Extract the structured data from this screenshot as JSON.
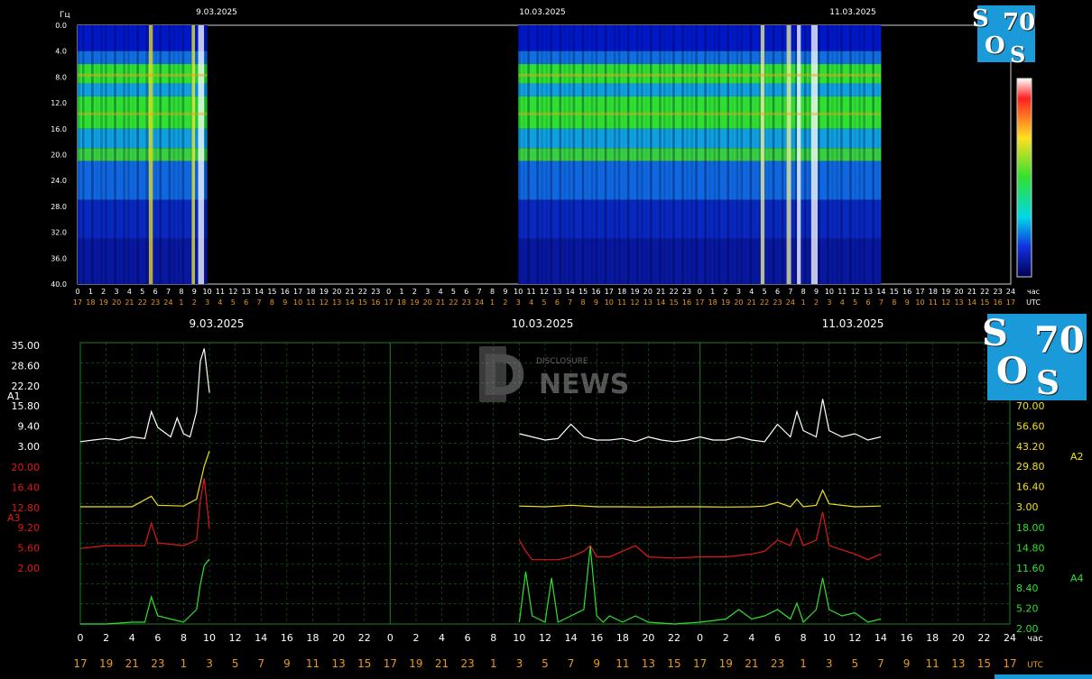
{
  "logo": {
    "s1": "S",
    "seventy": "70",
    "o": "O",
    "s2": "S"
  },
  "watermark": {
    "d": "D",
    "disclosure": "DISCLOSURE",
    "news": "NEWS"
  },
  "spectrogram": {
    "freq_unit": "Гц",
    "dates": [
      "9.03.2025",
      "10.03.2025",
      "11.03.2025"
    ],
    "freq_ticks": [
      "0.0",
      "4.0",
      "8.0",
      "12.0",
      "16.0",
      "20.0",
      "24.0",
      "28.0",
      "32.0",
      "36.0",
      "40.0"
    ],
    "hour_unit": "час",
    "utc_label": "UTC",
    "time_row_1": [
      "0",
      "1",
      "2",
      "3",
      "4",
      "5",
      "6",
      "7",
      "8",
      "9",
      "10",
      "11",
      "12",
      "13",
      "14",
      "15",
      "16",
      "17",
      "18",
      "19",
      "20",
      "21",
      "22",
      "23",
      "0",
      "1",
      "2",
      "3",
      "4",
      "5",
      "6",
      "7",
      "8",
      "9",
      "10",
      "11",
      "12",
      "13",
      "14",
      "15",
      "16",
      "17",
      "18",
      "19",
      "20",
      "21",
      "22",
      "23",
      "0",
      "1",
      "2",
      "3",
      "4",
      "5",
      "6",
      "7",
      "8",
      "9",
      "10",
      "11",
      "12",
      "13",
      "14",
      "15",
      "16",
      "17",
      "18",
      "19",
      "20",
      "21",
      "22",
      "23",
      "24"
    ],
    "time_row_2": [
      "17",
      "18",
      "19",
      "20",
      "21",
      "22",
      "23",
      "24",
      "1",
      "2",
      "3",
      "4",
      "5",
      "6",
      "7",
      "8",
      "9",
      "10",
      "11",
      "12",
      "13",
      "14",
      "15",
      "16",
      "17",
      "18",
      "19",
      "20",
      "21",
      "22",
      "23",
      "24",
      "1",
      "2",
      "3",
      "4",
      "5",
      "6",
      "7",
      "8",
      "9",
      "10",
      "11",
      "12",
      "13",
      "14",
      "15",
      "16",
      "17",
      "18",
      "19",
      "20",
      "21",
      "22",
      "23",
      "24",
      "1",
      "2",
      "3",
      "4",
      "5",
      "6",
      "7",
      "8",
      "9",
      "10",
      "11",
      "12",
      "13",
      "14",
      "15",
      "16",
      "17"
    ],
    "colors": {
      "black": "#000000",
      "blue": "#0018c8",
      "cyan": "#00c8d8",
      "green": "#30e030",
      "yellow": "#f0e020",
      "red": "#e01010",
      "white": "#ffffff"
    }
  },
  "amplitude": {
    "dates": [
      "9.03.2025",
      "10.03.2025",
      "11.03.2025"
    ],
    "channels": [
      {
        "name": "A1",
        "color": "#ffffff",
        "side": "left",
        "ticks": [
          "35.00",
          "28.60",
          "22.20",
          "15.80",
          "9.40",
          "3.00"
        ]
      },
      {
        "name": "A3",
        "color": "#e01818",
        "side": "left",
        "ticks": [
          "20.00",
          "16.40",
          "12.80",
          "9.20",
          "5.60",
          "2.00"
        ]
      },
      {
        "name": "A2",
        "color": "#f0e020",
        "side": "right",
        "ticks": [
          "70.00",
          "56.60",
          "43.20",
          "29.80",
          "16.40",
          "3.00"
        ]
      },
      {
        "name": "A4",
        "color": "#30e030",
        "side": "right",
        "ticks": [
          "18.00",
          "14.80",
          "11.60",
          "8.40",
          "5.20",
          "2.00"
        ]
      }
    ],
    "hour_unit": "час",
    "utc_label": "UTC",
    "time_row_1": [
      "0",
      "2",
      "4",
      "6",
      "8",
      "10",
      "12",
      "14",
      "16",
      "18",
      "20",
      "22",
      "0",
      "2",
      "4",
      "6",
      "8",
      "10",
      "12",
      "14",
      "16",
      "18",
      "20",
      "22",
      "0",
      "2",
      "4",
      "6",
      "8",
      "10",
      "12",
      "14",
      "16",
      "18",
      "20",
      "22",
      "24"
    ],
    "time_row_2": [
      "17",
      "19",
      "21",
      "23",
      "1",
      "3",
      "5",
      "7",
      "9",
      "11",
      "13",
      "15",
      "17",
      "19",
      "21",
      "23",
      "1",
      "3",
      "5",
      "7",
      "9",
      "11",
      "13",
      "15",
      "17",
      "19",
      "21",
      "23",
      "1",
      "3",
      "5",
      "7",
      "9",
      "11",
      "13",
      "15",
      "17"
    ],
    "colors": {
      "grid": "#1a6a1a",
      "label_white": "#ffffff",
      "label_orange": "#e89a18"
    }
  },
  "chart_data": [
    {
      "type": "heatmap",
      "title": "",
      "ylabel": "Гц",
      "ylim": [
        0,
        40
      ],
      "x_range_hours": [
        0,
        72
      ],
      "data_gaps_hours": [
        [
          10,
          34
        ],
        [
          62,
          72
        ]
      ],
      "dates": [
        "9.03.2025",
        "10.03.2025",
        "11.03.2025"
      ]
    },
    {
      "type": "line",
      "x_range_hours": [
        0,
        72
      ],
      "series": [
        {
          "name": "A1",
          "x": [
            0,
            1,
            2,
            3,
            4,
            5,
            5.5,
            6,
            7,
            7.5,
            8,
            8.5,
            9,
            9.3,
            9.6,
            10,
            34,
            35,
            36,
            37,
            38,
            39,
            40,
            41,
            42,
            43,
            44,
            45,
            46,
            47,
            48,
            49,
            50,
            51,
            52,
            53,
            54,
            55,
            55.5,
            56,
            57,
            57.5,
            58,
            59,
            60,
            61,
            62
          ],
          "y": [
            4.5,
            5,
            5.5,
            5,
            6,
            5.5,
            14,
            9,
            6,
            12,
            7,
            6,
            14,
            30,
            34,
            20,
            7,
            6,
            5,
            5.5,
            10,
            6,
            5,
            5,
            5.5,
            4.5,
            6,
            5,
            4.5,
            5,
            6,
            5,
            5,
            6,
            5,
            4.5,
            10,
            6,
            14,
            8,
            6,
            18,
            8,
            6,
            7,
            5,
            6
          ]
        },
        {
          "name": "A2",
          "x": [
            0,
            2,
            4,
            5.5,
            6,
            8,
            9,
            9.6,
            10,
            34,
            36,
            38,
            40,
            42,
            44,
            46,
            48,
            50,
            52,
            53,
            54,
            55,
            55.5,
            56,
            57,
            57.5,
            58,
            60,
            62
          ],
          "y": [
            3,
            3,
            3,
            10,
            4,
            3.5,
            8,
            30,
            40,
            3.5,
            3,
            4,
            3,
            3,
            2.8,
            3,
            3,
            2.8,
            3,
            3.5,
            6,
            3,
            8,
            3,
            4,
            14,
            5,
            3,
            3.5
          ]
        },
        {
          "name": "A3",
          "x": [
            0,
            2,
            4,
            5,
            5.5,
            6,
            8,
            9,
            9.3,
            9.6,
            10,
            34,
            34.5,
            35,
            36,
            37,
            38,
            39,
            39.5,
            40,
            41,
            42,
            43,
            44,
            46,
            48,
            50,
            52,
            53,
            54,
            55,
            55.5,
            56,
            57,
            57.5,
            58,
            60,
            61,
            62
          ],
          "y": [
            5.5,
            6,
            6,
            6,
            10,
            6.5,
            6,
            7,
            14,
            18,
            9,
            7,
            5,
            3.5,
            3.5,
            3.5,
            4,
            5,
            6,
            4,
            4,
            5,
            6,
            4,
            3.8,
            4,
            4,
            4.5,
            5,
            7,
            6,
            9,
            6,
            7,
            12,
            6,
            4.5,
            3.5,
            4.5
          ]
        },
        {
          "name": "A4",
          "x": [
            0,
            2,
            4,
            5,
            5.5,
            6,
            8,
            9,
            9.3,
            9.6,
            10,
            34,
            34.5,
            35,
            36,
            36.5,
            37,
            38,
            39,
            39.5,
            40,
            40.5,
            41,
            42,
            43,
            44,
            46,
            48,
            50,
            51,
            52,
            53,
            54,
            55,
            55.5,
            56,
            57,
            57.5,
            58,
            59,
            60,
            61,
            62
          ],
          "y": [
            2.5,
            2.5,
            3,
            3,
            7,
            4,
            3,
            5,
            9,
            12,
            13,
            3,
            11,
            4,
            3,
            10,
            3,
            4,
            5,
            15,
            4,
            3,
            4,
            3,
            4,
            3,
            2.5,
            3,
            3.5,
            5,
            3.5,
            4,
            5,
            3.5,
            6,
            3,
            5,
            10,
            5,
            4,
            4.5,
            3,
            3.5
          ]
        }
      ]
    }
  ]
}
